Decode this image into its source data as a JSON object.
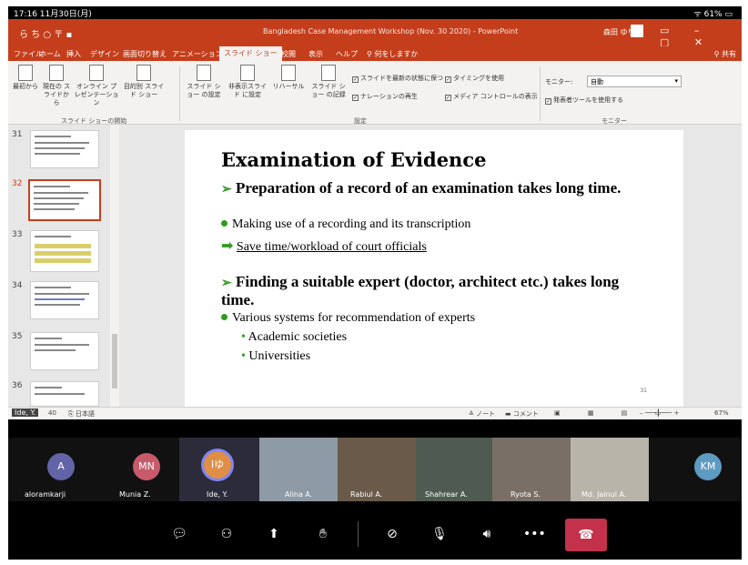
{
  "ios_status": {
    "time": "17:16 11月30日(月)",
    "battery": "61%"
  },
  "titlebar": {
    "doc_title": "Bangladesh Case Management Workshop (Nov. 30 2020) - PowerPoint",
    "user": "森田 ゆり",
    "autosave": "ら ち ○ 〒 ▪"
  },
  "menu": {
    "items": [
      "ファイル",
      "ホーム",
      "挿入",
      "デザイン",
      "画面切り替え",
      "アニメーション",
      "スライド ショー",
      "校閲",
      "表示",
      "ヘルプ",
      "何をしますか"
    ],
    "active_index": 6,
    "share": "共有"
  },
  "ribbon": {
    "group_start": {
      "label": "スライド ショーの開始",
      "buttons": [
        "最初から",
        "現在の スライドから",
        "オンライン プレゼンテーション",
        "目的別 スライド ショー"
      ]
    },
    "group_setup": {
      "label": "設定",
      "buttons": [
        "スライド ショー の設定",
        "非表示スライド に設定",
        "リハーサル",
        "スライド ショー の記録"
      ]
    },
    "checks": [
      "スライドを最新の状態に保つ",
      "ナレーションの再生",
      "タイミングを使用",
      "メディア コントロールの表示"
    ],
    "group_monitor": {
      "label": "モニター",
      "monitor_label": "モニター:",
      "monitor_value": "自動",
      "presenter": "発表者ツールを使用する"
    }
  },
  "thumbnails": [
    {
      "num": "31",
      "selected": false
    },
    {
      "num": "32",
      "selected": true
    },
    {
      "num": "33",
      "selected": false
    },
    {
      "num": "34",
      "selected": false
    },
    {
      "num": "35",
      "selected": false
    },
    {
      "num": "36",
      "selected": false
    }
  ],
  "slide": {
    "title": "Examination of Evidence",
    "bullet1": "Preparation of a record of an examination takes long time.",
    "sub1": "Making use of a recording and its transcription",
    "sub1_arrow": "Save time/workload of court officials",
    "bullet2": "Finding a suitable expert (doctor, architect etc.) takes long time.",
    "sub2": "Various systems for recommendation of experts",
    "sub2_items": [
      "Academic societies",
      "Universities"
    ],
    "page_number": "31"
  },
  "pp_status": {
    "overlay_name": "Ide, Y.",
    "slide_of": "40",
    "lang": "日本語",
    "notes": "ノート",
    "comments": "コメント",
    "zoom": "67%"
  },
  "participants": [
    {
      "name": "aloramkarji",
      "initials": "A",
      "color": "#6264a7",
      "kind": "avatar"
    },
    {
      "name": "Munia Z.",
      "initials": "MN",
      "color": "#c75b6b",
      "kind": "avatar"
    },
    {
      "name": "Ide, Y.",
      "initials": "Iゆ",
      "color": "#e08e45",
      "kind": "avatar-active"
    },
    {
      "name": "Alina A.",
      "kind": "video"
    },
    {
      "name": "Rabiul A.",
      "kind": "video"
    },
    {
      "name": "Shahrear A.",
      "kind": "video"
    },
    {
      "name": "Ryota S.",
      "kind": "video"
    },
    {
      "name": "Md. Jainul A.",
      "kind": "video"
    },
    {
      "name": "",
      "initials": "KM",
      "color": "#5e9bc2",
      "kind": "avatar"
    }
  ],
  "controls": [
    "chat",
    "participants",
    "share",
    "raise-hand",
    "camera-off",
    "mic-off",
    "speaker",
    "more",
    "hangup"
  ],
  "colors": {
    "ppt_accent": "#c43e1c",
    "bullet_green": "#2e9b1f",
    "hangup": "#c4314b"
  }
}
